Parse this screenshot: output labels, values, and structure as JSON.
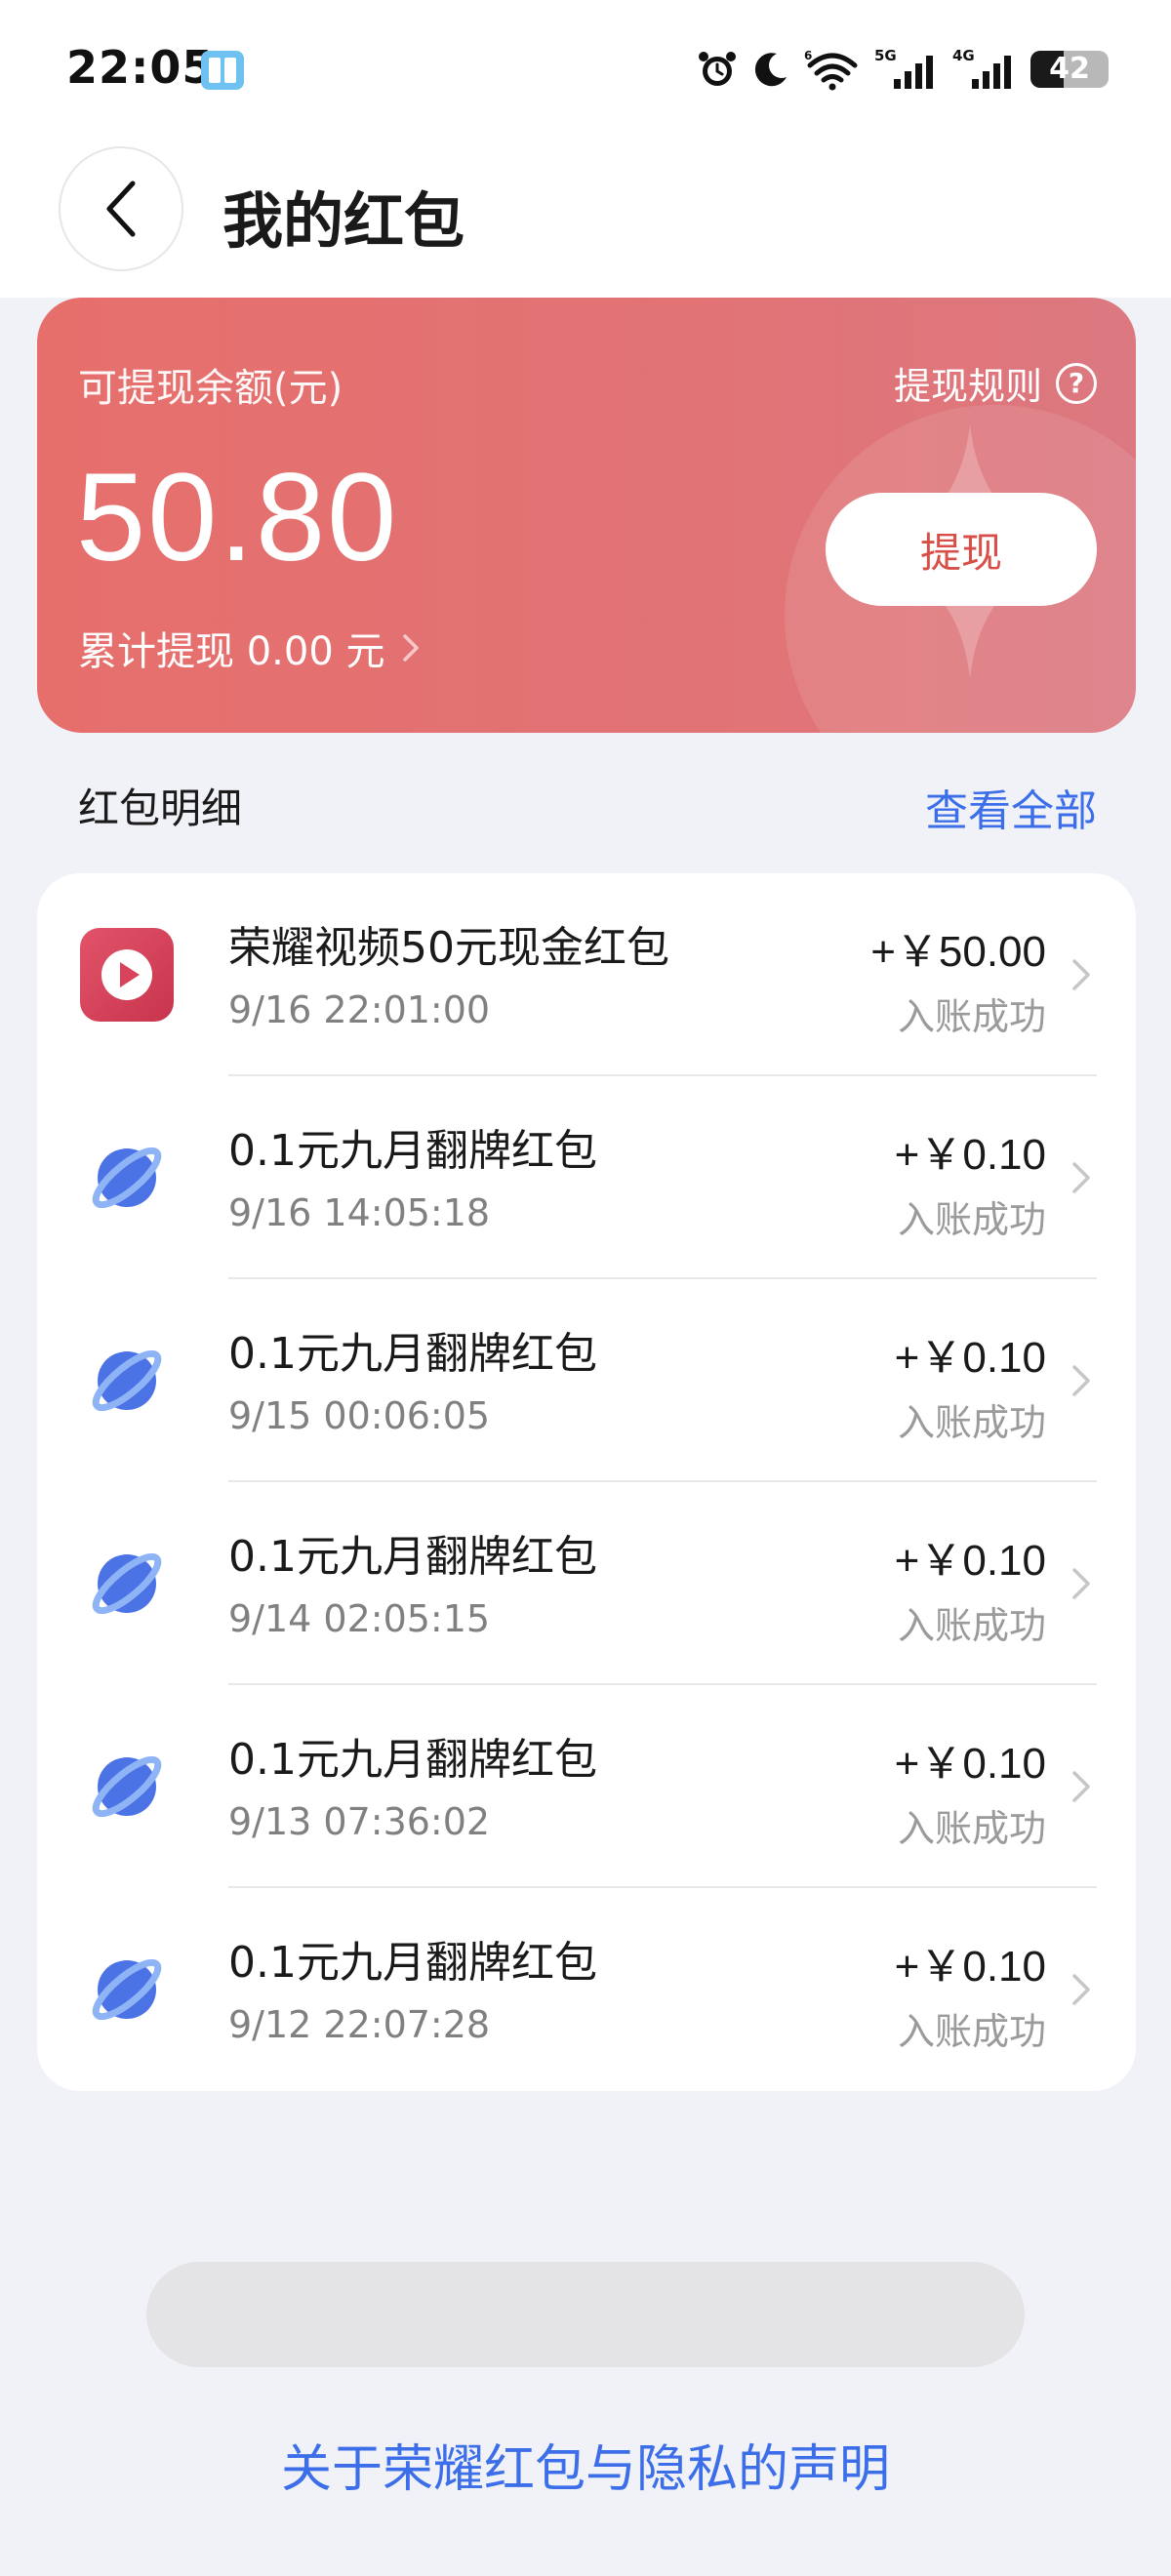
{
  "status_bar": {
    "time": "22:05",
    "battery_level": "42",
    "battery_percent": 42,
    "network_5g": "5G",
    "network_4g": "4G"
  },
  "header": {
    "title": "我的红包"
  },
  "balance_card": {
    "label": "可提现余额(元)",
    "amount": "50.80",
    "rules_label": "提现规则",
    "withdraw_label": "提现",
    "total_withdraw": "累计提现 0.00 元"
  },
  "detail_section": {
    "title": "红包明细",
    "view_all": "查看全部"
  },
  "items": [
    {
      "title": "荣耀视频50元现金红包",
      "time": "9/16 22:01:00",
      "amount": "+￥50.00",
      "status": "入账成功",
      "icon": "video-app-icon"
    },
    {
      "title": "0.1元九月翻牌红包",
      "time": "9/16 14:05:18",
      "amount": "+￥0.10",
      "status": "入账成功",
      "icon": "planet-icon"
    },
    {
      "title": "0.1元九月翻牌红包",
      "time": "9/15 00:06:05",
      "amount": "+￥0.10",
      "status": "入账成功",
      "icon": "planet-icon"
    },
    {
      "title": "0.1元九月翻牌红包",
      "time": "9/14 02:05:15",
      "amount": "+￥0.10",
      "status": "入账成功",
      "icon": "planet-icon"
    },
    {
      "title": "0.1元九月翻牌红包",
      "time": "9/13 07:36:02",
      "amount": "+￥0.10",
      "status": "入账成功",
      "icon": "planet-icon"
    },
    {
      "title": "0.1元九月翻牌红包",
      "time": "9/12 22:07:28",
      "amount": "+￥0.10",
      "status": "入账成功",
      "icon": "planet-icon"
    }
  ],
  "footer": {
    "privacy_link": "关于荣耀红包与隐私的声明"
  },
  "colors": {
    "accent": "#3b6ee8",
    "card_red": "#e26f70",
    "withdraw_text": "#d74f48",
    "background": "#f1f2f7"
  }
}
